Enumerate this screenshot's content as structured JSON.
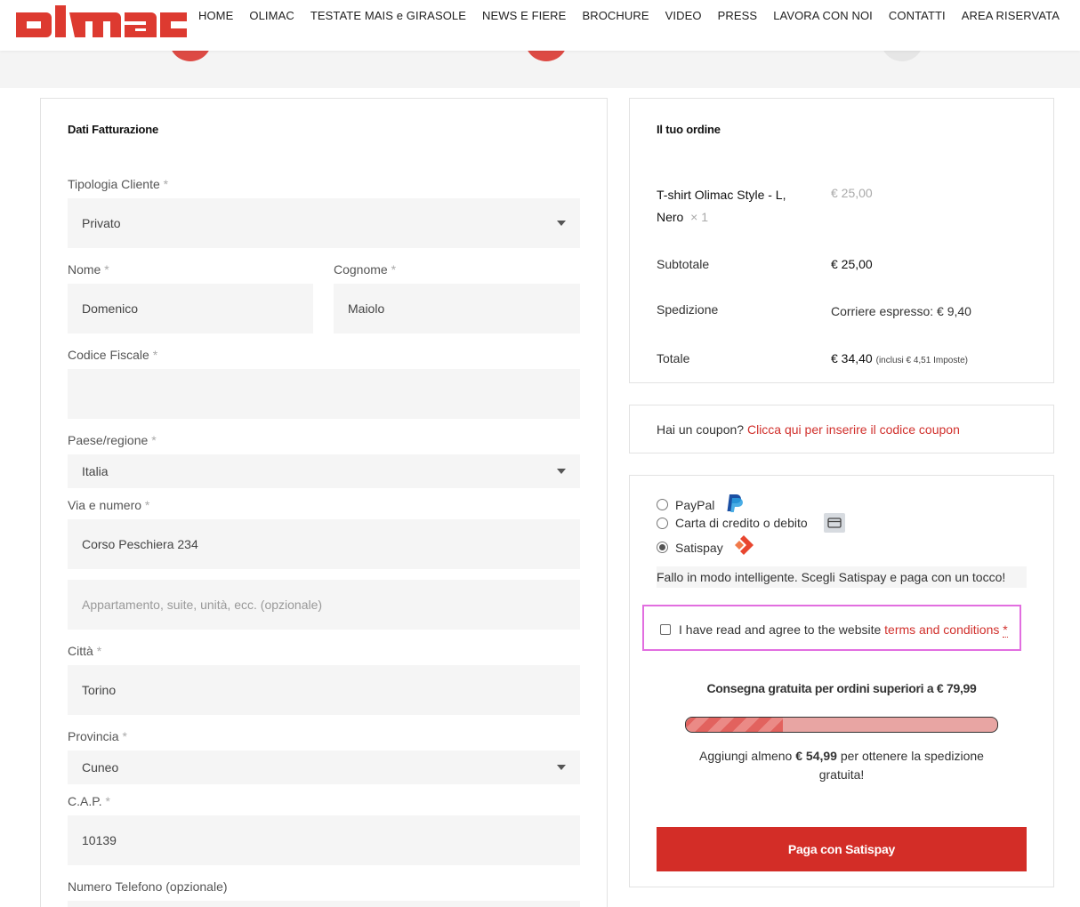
{
  "header": {
    "logo_text": "olmac",
    "nav": [
      "HOME",
      "OLIMAC",
      "TESTATE MAIS e GIRASOLE",
      "NEWS E FIERE",
      "BROCHURE",
      "VIDEO",
      "PRESS",
      "LAVORA CON NOI",
      "CONTATTI",
      "AREA RISERVATA"
    ]
  },
  "billing": {
    "title": "Dati Fatturazione",
    "fields": {
      "tipologia": {
        "label": "Tipologia Cliente",
        "value": "Privato"
      },
      "nome": {
        "label": "Nome",
        "value": "Domenico"
      },
      "cognome": {
        "label": "Cognome",
        "value": "Maiolo"
      },
      "codice_fiscale": {
        "label": "Codice Fiscale",
        "value": ""
      },
      "paese": {
        "label": "Paese/regione",
        "value": "Italia"
      },
      "via": {
        "label": "Via e numero",
        "value": "Corso Peschiera 234"
      },
      "appartamento": {
        "placeholder": "Appartamento, suite, unità, ecc. (opzionale)"
      },
      "citta": {
        "label": "Città",
        "value": "Torino"
      },
      "provincia": {
        "label": "Provincia",
        "value": "Cuneo"
      },
      "cap": {
        "label": "C.A.P.",
        "value": "10139"
      },
      "telefono": {
        "label": "Numero Telefono (opzionale)"
      }
    },
    "required_mark": "*"
  },
  "order": {
    "title": "Il tuo ordine",
    "item_name_line1": "T-shirt Olimac Style - L,",
    "item_name_line2": "Nero",
    "item_qty": "× 1",
    "item_price": "€ 25,00",
    "subtotal_label": "Subtotale",
    "subtotal_value": "€ 25,00",
    "shipping_label": "Spedizione",
    "shipping_value": "Corriere espresso: € 9,40",
    "total_label": "Totale",
    "total_value": "€ 34,40",
    "total_tax": "(inclusi € 4,51 Imposte)"
  },
  "coupon": {
    "text": "Hai un coupon?",
    "link": "Clicca qui per inserire il codice coupon"
  },
  "payment": {
    "methods": [
      {
        "label": "PayPal",
        "icon": "paypal-icon",
        "selected": false
      },
      {
        "label": "Carta di credito o debito",
        "icon": "credit-card-icon",
        "selected": false
      },
      {
        "label": "Satispay",
        "icon": "satispay-icon",
        "selected": true
      }
    ],
    "description": "Fallo in modo intelligente. Scegli Satispay e paga con un tocco!",
    "terms_text": "I have read and agree to the website",
    "terms_link": "terms and conditions",
    "terms_required": "*",
    "free_shipping_title": "Consegna gratuita per ordini superiori a € 79,99",
    "progress_fraction": 0.31,
    "free_shipping_note_prefix": "Aggiungi almeno",
    "free_shipping_amount": "€ 54,99",
    "free_shipping_note_suffix": "per ottenere la spedizione gratuita!",
    "pay_button": "Paga con Satispay"
  },
  "colors": {
    "brand_red": "#dd3a30",
    "button_red": "#d32d27",
    "link_red": "#d1302c",
    "highlight_border": "#e26ee0"
  }
}
